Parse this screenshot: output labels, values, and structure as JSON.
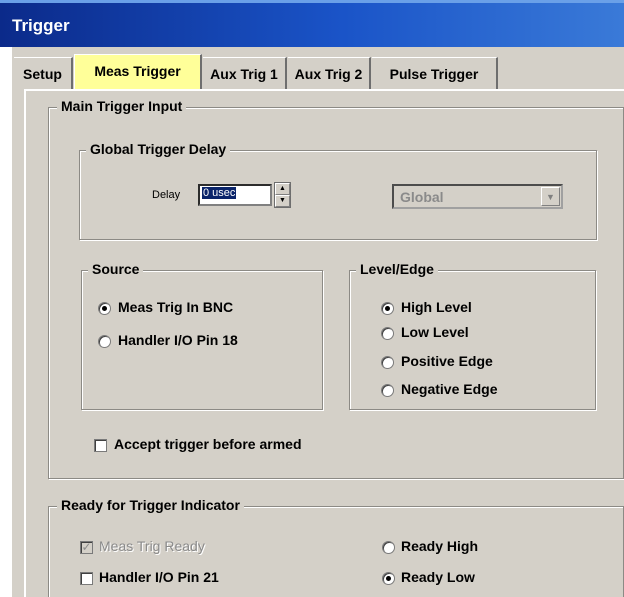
{
  "window": {
    "title": "Trigger"
  },
  "tabs": [
    {
      "label": "Setup",
      "active": false
    },
    {
      "label": "Meas Trigger",
      "active": true
    },
    {
      "label": "Aux Trig 1",
      "active": false
    },
    {
      "label": "Aux Trig 2",
      "active": false
    },
    {
      "label": "Pulse Trigger",
      "active": false
    }
  ],
  "main_trigger": {
    "title": "Main Trigger Input",
    "global_delay": {
      "title": "Global Trigger Delay",
      "delay_label": "Delay",
      "delay_value": "0 usec",
      "scope_value": "Global"
    },
    "source": {
      "title": "Source",
      "options": [
        {
          "label": "Meas Trig In BNC",
          "selected": true
        },
        {
          "label": "Handler I/O Pin 18",
          "selected": false
        }
      ]
    },
    "level_edge": {
      "title": "Level/Edge",
      "options": [
        {
          "label": "High Level",
          "selected": true
        },
        {
          "label": "Low Level",
          "selected": false
        },
        {
          "label": "Positive Edge",
          "selected": false
        },
        {
          "label": "Negative Edge",
          "selected": false
        }
      ]
    },
    "accept_before_armed": {
      "label": "Accept trigger before armed",
      "checked": false
    }
  },
  "ready_indicator": {
    "title": "Ready for Trigger Indicator",
    "meas_trig_ready": {
      "label": "Meas Trig Ready",
      "checked": true,
      "enabled": false
    },
    "handler_pin": {
      "label": "Handler I/O Pin 21",
      "checked": false
    },
    "ready_high": {
      "label": "Ready High",
      "selected": false
    },
    "ready_low": {
      "label": "Ready Low",
      "selected": true
    }
  },
  "colors": {
    "title_bar": "#0b2a8a",
    "dialog_face": "#d4d0c8",
    "active_tab": "#ffff99",
    "selection": "#0a246a"
  }
}
